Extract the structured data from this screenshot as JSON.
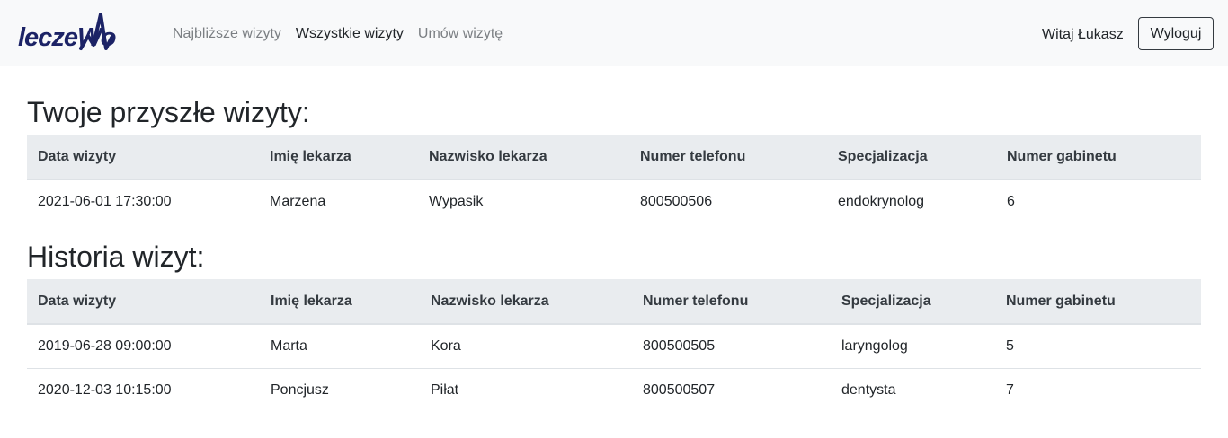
{
  "navbar": {
    "logo_text": "leczeWo",
    "links": [
      "Najbliższe wizyty",
      "Wszystkie wizyty",
      "Umów wizytę"
    ],
    "active_link": "Wszystkie wizyty",
    "greeting": "Witaj Łukasz",
    "logout_label": "Wyloguj"
  },
  "future": {
    "title": "Twoje przyszłe wizyty:",
    "headers": [
      "Data wizyty",
      "Imię lekarza",
      "Nazwisko lekarza",
      "Numer telefonu",
      "Specjalizacja",
      "Numer gabinetu"
    ],
    "rows": [
      [
        "2021-06-01 17:30:00",
        "Marzena",
        "Wypasik",
        "800500506",
        "endokrynolog",
        "6"
      ]
    ]
  },
  "history": {
    "title": "Historia wizyt:",
    "headers": [
      "Data wizyty",
      "Imię lekarza",
      "Nazwisko lekarza",
      "Numer telefonu",
      "Specjalizacja",
      "Numer gabinetu"
    ],
    "rows": [
      [
        "2019-06-28 09:00:00",
        "Marta",
        "Kora",
        "800500505",
        "laryngolog",
        "5"
      ],
      [
        "2020-12-03 10:15:00",
        "Poncjusz",
        "Piłat",
        "800500507",
        "dentysta",
        "7"
      ]
    ]
  },
  "colors": {
    "brand": "#1c2366",
    "navbar_bg": "#f8f9fa",
    "table_head_bg": "#e9ecef"
  }
}
